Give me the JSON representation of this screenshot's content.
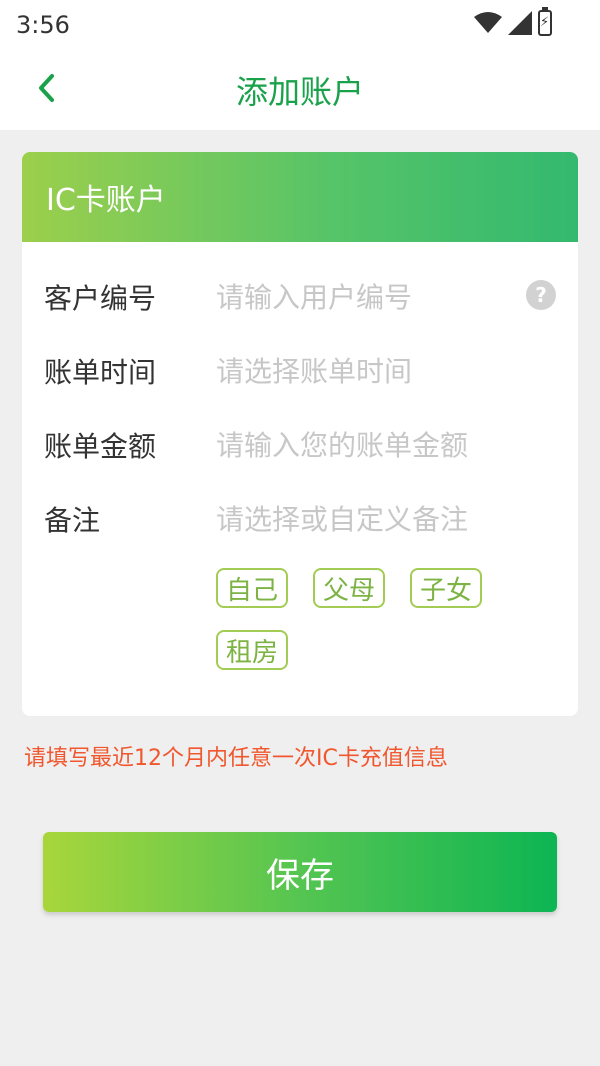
{
  "status_bar": {
    "time": "3:56",
    "icons": [
      "wifi-icon",
      "signal-icon",
      "battery-charging-icon"
    ]
  },
  "nav": {
    "title": "添加账户",
    "back_icon": "chevron-left-icon"
  },
  "card": {
    "header_title": "IC卡账户",
    "fields": [
      {
        "label": "客户编号",
        "placeholder": "请输入用户编号",
        "value": ""
      },
      {
        "label": "账单时间",
        "placeholder": "请选择账单时间",
        "value": ""
      },
      {
        "label": "账单金额",
        "placeholder": "请输入您的账单金额",
        "value": ""
      },
      {
        "label": "备注",
        "placeholder": "请选择或自定义备注",
        "value": ""
      }
    ],
    "help_icon_glyph": "?",
    "tags": [
      "自己",
      "父母",
      "子女",
      "租房"
    ]
  },
  "notice": "请填写最近12个月内任意一次IC卡充值信息",
  "save_button_label": "保存",
  "colors": {
    "accent_green": "#1aa24b",
    "tag_border": "#a3cc55",
    "notice_red": "#f0572e",
    "background": "#efefef"
  }
}
